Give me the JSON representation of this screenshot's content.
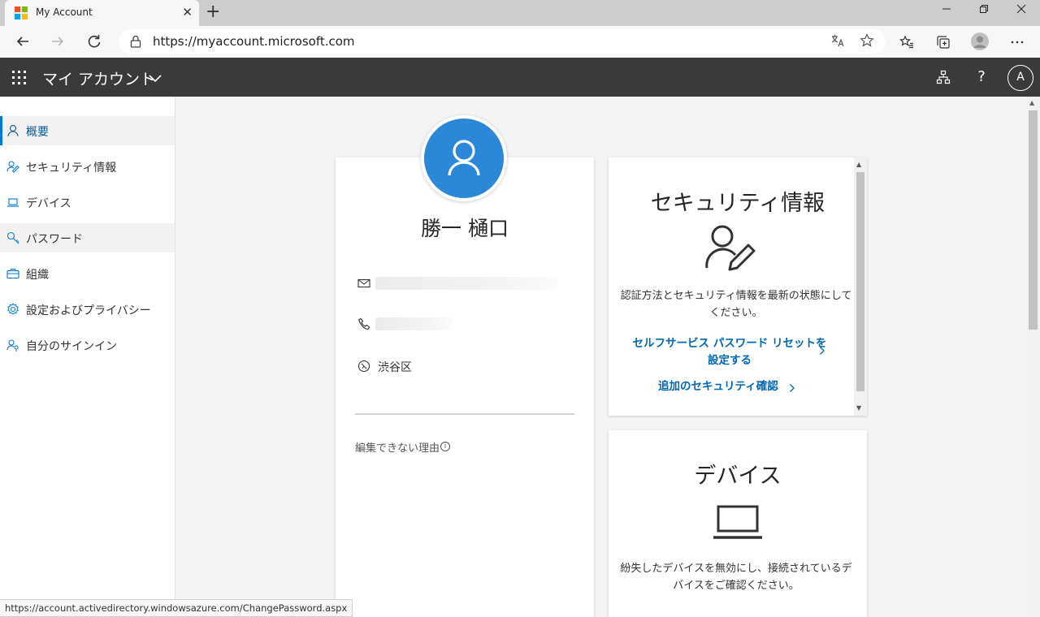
{
  "browser": {
    "tab_title": "My Account",
    "tab_close": "✕",
    "new_tab": "+",
    "url": "https://myaccount.microsoft.com",
    "status_url": "https://account.activedirectory.windowsazure.com/ChangePassword.aspx",
    "icons": [
      "back-icon",
      "forward-icon",
      "refresh-icon",
      "lock-icon",
      "translate-icon",
      "favorite-star-icon",
      "favorites-icon",
      "collections-icon",
      "profile-icon",
      "more-icon",
      "minimize-icon",
      "maximize-icon",
      "close-icon"
    ]
  },
  "header": {
    "app_title": "マイ アカウント",
    "help_label": "?",
    "avatar_initial": "A",
    "bg_color": "#3b3a39"
  },
  "nav": {
    "items": [
      {
        "label": "概要",
        "icon": "person-icon",
        "active": true
      },
      {
        "label": "セキュリティ情報",
        "icon": "person-key-icon"
      },
      {
        "label": "デバイス",
        "icon": "laptop-icon"
      },
      {
        "label": "パスワード",
        "icon": "key-icon"
      },
      {
        "label": "組織",
        "icon": "briefcase-icon"
      },
      {
        "label": "設定およびプライバシー",
        "icon": "gear-icon"
      },
      {
        "label": "自分のサインイン",
        "icon": "person-key-icon"
      }
    ],
    "accent_color": "#0078d4"
  },
  "profile": {
    "name": "勝一 樋口",
    "location": "渋谷区",
    "why_not_edit": "編集できない理由",
    "info_symbol": "i",
    "avatar_color": "#2b88d8"
  },
  "security_card": {
    "title": "セキュリティ情報",
    "description": "認証方法とセキュリティ情報を最新の状態にしてください。",
    "link_sspr": "セルフサービス パスワード リセットを設定する",
    "link_additional": "追加のセキュリティ確認",
    "link_color": "#0067b8"
  },
  "devices_card": {
    "title": "デバイス",
    "description": "紛失したデバイスを無効にし、接続されているデバイスをご確認ください。"
  }
}
